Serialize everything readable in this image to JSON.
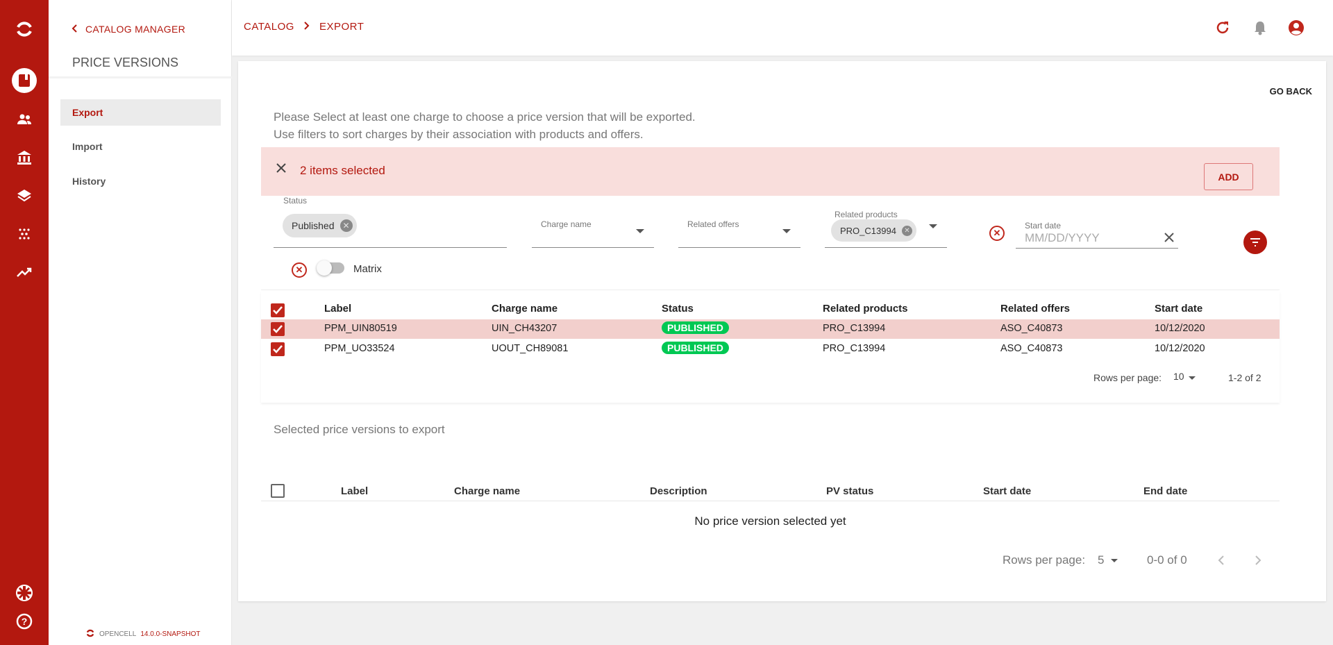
{
  "rail": {
    "icons": [
      "opencell-logo-icon",
      "book-icon",
      "people-icon",
      "bank-icon",
      "layers-icon",
      "dots-icon",
      "trending-icon",
      "language-flag-icon",
      "help-icon"
    ]
  },
  "sidebar": {
    "back_label": "CATALOG MANAGER",
    "title": "PRICE VERSIONS",
    "items": [
      {
        "label": "Export"
      },
      {
        "label": "Import"
      },
      {
        "label": "History"
      }
    ],
    "version_brand": "OPENCELL",
    "version": "14.0.0-SNAPSHOT"
  },
  "breadcrumb": {
    "root": "CATALOG",
    "current": "EXPORT"
  },
  "go_back": "GO BACK",
  "instructions": {
    "line1": "Please Select at least one charge to choose a price version that will be exported.",
    "line2": "Use filters to sort charges by their association with products and offers."
  },
  "selection": {
    "count_text": "2 items selected",
    "add_label": "ADD"
  },
  "filters": {
    "status": {
      "label": "Status",
      "chip": "Published"
    },
    "charge_name": {
      "label": "Charge name"
    },
    "related_offers": {
      "label": "Related offers"
    },
    "related_products": {
      "label": "Related products",
      "chip": "PRO_C13994"
    },
    "start_date": {
      "label": "Start date",
      "placeholder": "MM/DD/YYYY"
    },
    "matrix_label": "Matrix"
  },
  "charges_table": {
    "headers": [
      "Label",
      "Charge name",
      "Status",
      "Related products",
      "Related offers",
      "Start date"
    ],
    "rows": [
      {
        "label": "PPM_UIN80519",
        "charge": "UIN_CH43207",
        "status": "PUBLISHED",
        "products": "PRO_C13994",
        "offers": "ASO_C40873",
        "start": "10/12/2020"
      },
      {
        "label": "PPM_UO33524",
        "charge": "UOUT_CH89081",
        "status": "PUBLISHED",
        "products": "PRO_C13994",
        "offers": "ASO_C40873",
        "start": "10/12/2020"
      }
    ],
    "rows_per_page_label": "Rows per page:",
    "rows_per_page": "10",
    "range": "1-2 of 2"
  },
  "export_section": {
    "title": "Selected price versions to export",
    "headers": [
      "Label",
      "Charge name",
      "Description",
      "PV status",
      "Start date",
      "End date"
    ],
    "empty_text": "No price version selected yet",
    "rows_per_page_label": "Rows per page:",
    "rows_per_page": "5",
    "range": "0-0 of 0"
  },
  "colors": {
    "brand": "#b3180f",
    "selected_row": "#f2cfcc",
    "published": "#00c853"
  }
}
